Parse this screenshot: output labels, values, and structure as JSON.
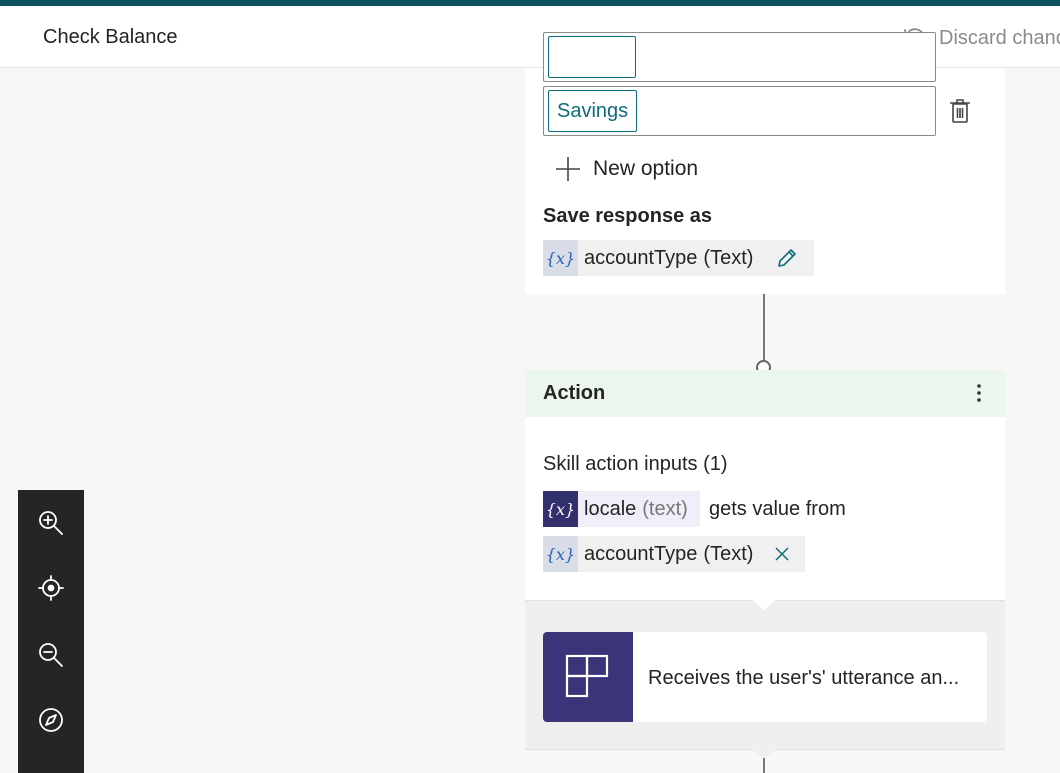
{
  "header": {
    "title": "Check Balance",
    "discard_label": "Discard chanc"
  },
  "question_card": {
    "options": [
      "Savings"
    ],
    "new_option_label": "New option",
    "save_response_label": "Save response as",
    "saved_variable": {
      "name": "accountType",
      "type": "(Text)"
    }
  },
  "action_card": {
    "title": "Action",
    "skill_inputs_label": "Skill action inputs (1)",
    "input_variable": {
      "name": "locale",
      "type": "(text)"
    },
    "gets_value_from_label": "gets value from",
    "source_variable": {
      "name": "accountType",
      "type": "(Text)"
    },
    "variable_badge": "{x}"
  },
  "skill": {
    "description": "Receives the user's' utterance an..."
  },
  "icons": {
    "discard": "history-icon",
    "delete": "trash-icon",
    "add": "plus-icon",
    "edit": "pencil-icon",
    "clear": "close-icon",
    "more": "more-vertical-icon",
    "zoom_in": "zoom-in-icon",
    "recenter": "target-icon",
    "zoom_out": "zoom-out-icon",
    "minimap": "compass-icon"
  },
  "colors": {
    "top_strip": "#0c535f",
    "accent_teal": "#0f6c7a",
    "action_header": "#ebf6ec",
    "skill_logo": "#3b3478",
    "variable_badge_dark": "#33306e",
    "zoom_bar": "#252525"
  }
}
